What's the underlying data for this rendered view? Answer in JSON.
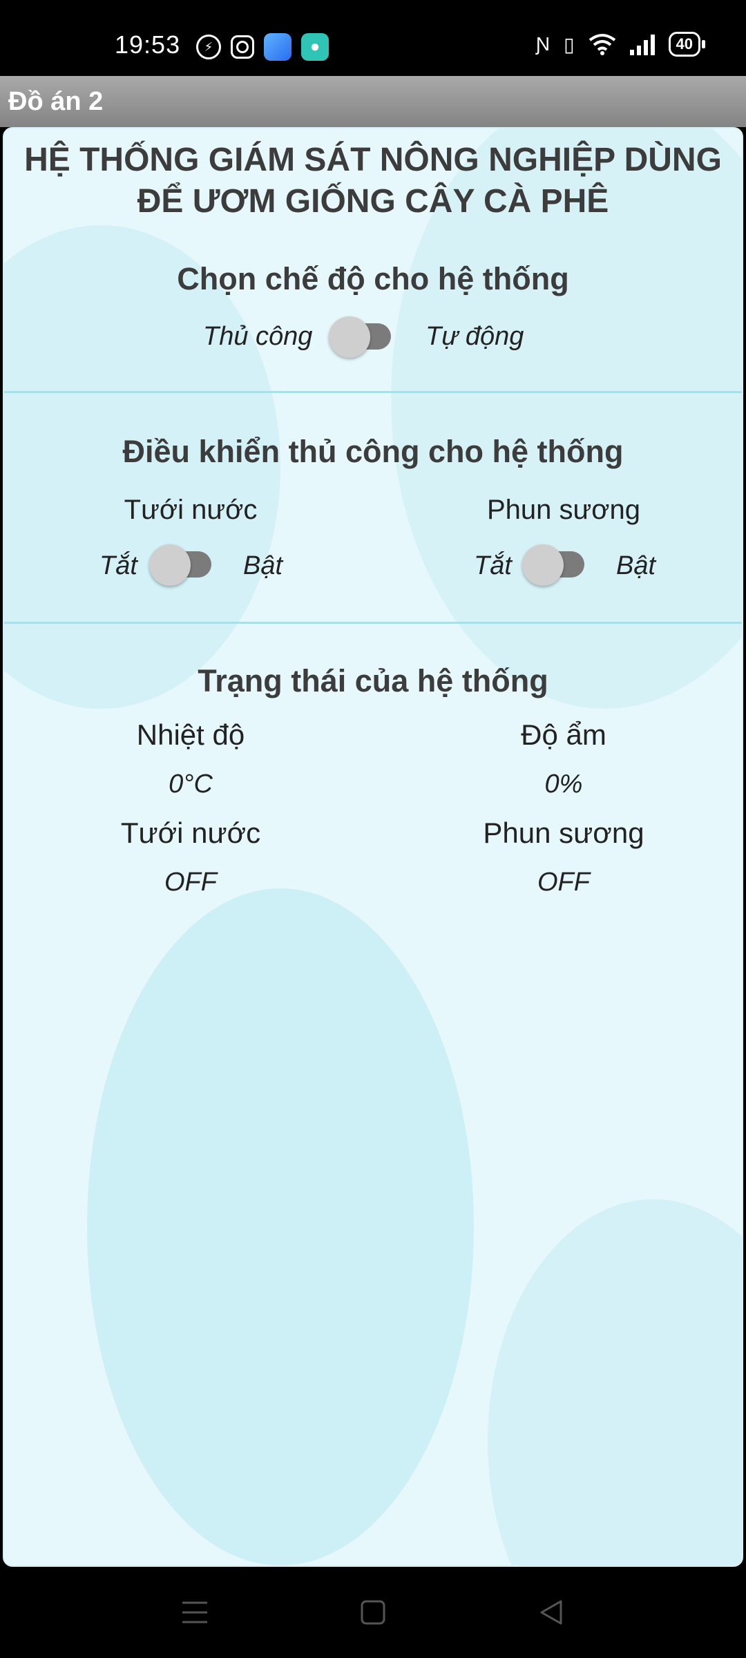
{
  "status_bar": {
    "time": "19:53",
    "network": "4G",
    "battery": "40",
    "icons": [
      "messenger-icon",
      "instagram-icon",
      "blue-app-icon",
      "teal-chat-icon",
      "nfc-icon",
      "vibrate-icon",
      "wifi-icon",
      "signal-icon",
      "battery-icon"
    ]
  },
  "header": {
    "title": "Đồ án 2"
  },
  "main": {
    "title_line1": "HỆ THỐNG GIÁM SÁT NÔNG NGHIỆP DÙNG",
    "title_line2": "ĐỂ ƯƠM GIỐNG CÂY CÀ PHÊ",
    "mode": {
      "heading": "Chọn chế độ cho hệ thống",
      "left_label": "Thủ công",
      "right_label": "Tự động",
      "is_on": false
    },
    "manual": {
      "heading": "Điều khiển thủ công cho hệ thống",
      "watering": {
        "label": "Tưới nước",
        "off_label": "Tắt",
        "on_label": "Bật",
        "is_on": false
      },
      "mist": {
        "label": "Phun sương",
        "off_label": "Tắt",
        "on_label": "Bật",
        "is_on": false
      }
    },
    "status": {
      "heading": "Trạng thái của hệ thống",
      "temperature_label": "Nhiệt độ",
      "temperature_value": "0°C",
      "humidity_label": "Độ ẩm",
      "humidity_value": "0%",
      "watering_label": "Tưới nước",
      "watering_value": "OFF",
      "mist_label": "Phun sương",
      "mist_value": "OFF"
    }
  },
  "nav_bar": {
    "icons": [
      "menu-icon",
      "home-icon",
      "back-icon"
    ]
  },
  "colors": {
    "background": "#e6f8fc",
    "switch_track": "#7b7b7b",
    "switch_thumb": "#cfcfcf",
    "divider": "#a8dfe8"
  }
}
